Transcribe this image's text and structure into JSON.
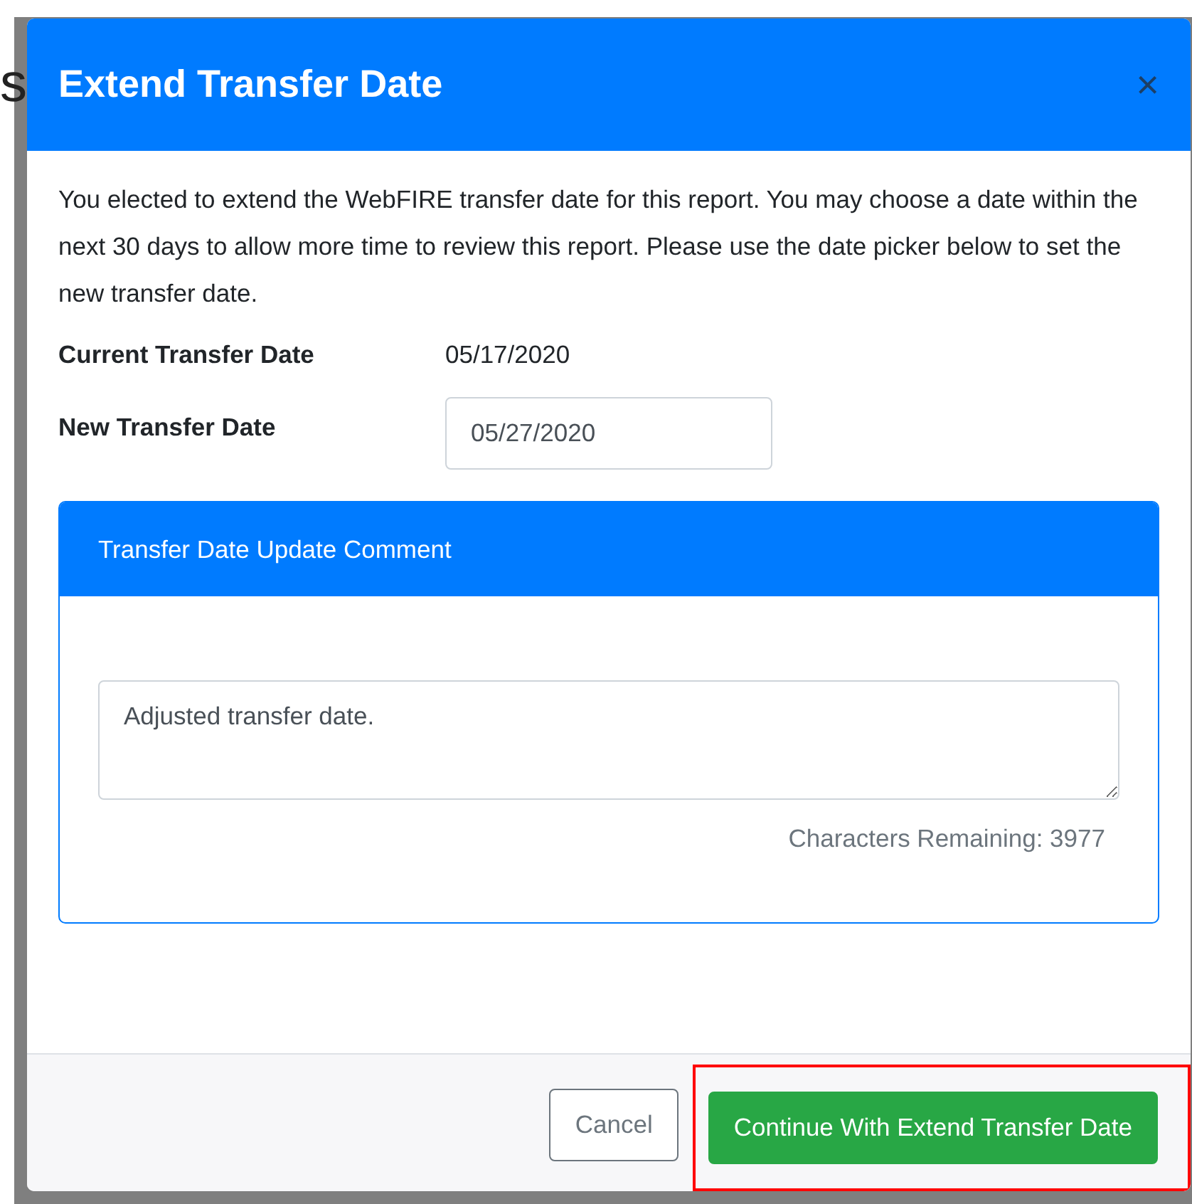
{
  "background": {
    "fragments": [
      "s"
    ]
  },
  "modal": {
    "title": "Extend Transfer Date",
    "close": "×",
    "intro": "You elected to extend the WebFIRE transfer date for this report. You may choose a date within the next 30 days to allow more time to review this report. Please use the date picker below to set the new transfer date.",
    "current": {
      "label": "Current Transfer Date",
      "value": "05/17/2020"
    },
    "new": {
      "label": "New Transfer Date",
      "value": "05/27/2020"
    },
    "comment": {
      "title": "Transfer Date Update Comment",
      "value": "Adjusted transfer date.",
      "remaining": "Characters Remaining: 3977"
    },
    "buttons": [
      {
        "label": "Cancel",
        "kind": "secondary",
        "highlighted": false
      },
      {
        "label": "Continue With Extend Transfer Date",
        "kind": "primary",
        "highlighted": true
      }
    ]
  }
}
